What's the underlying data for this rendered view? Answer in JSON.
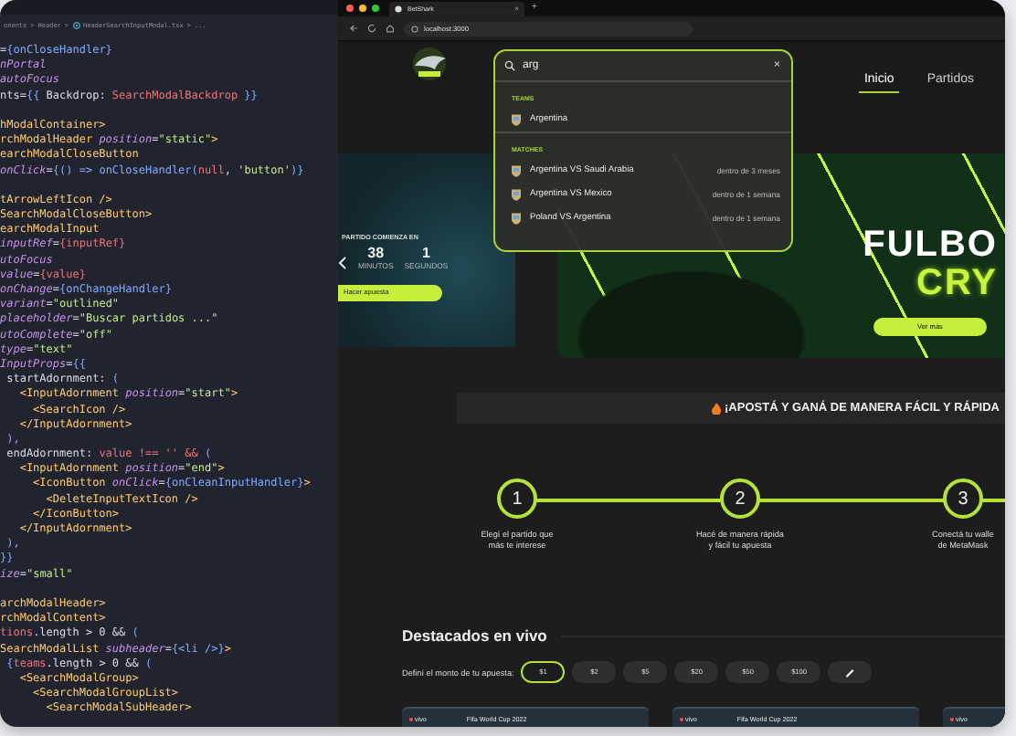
{
  "editor": {
    "breadcrumb": {
      "separator": ">",
      "parts": [
        {
          "text": "onents",
          "kind": "folder"
        },
        {
          "text": "Header",
          "kind": "folder"
        },
        {
          "text": "HeaderSearchInputModal.tsx",
          "kind": "file"
        },
        {
          "text": "...",
          "kind": "folder"
        }
      ]
    },
    "lines": [
      {
        "kind": "code",
        "tokens": [
          {
            "kind": "plain",
            "text": "="
          },
          {
            "kind": "expr",
            "text": "{onCloseHandler}"
          }
        ]
      },
      {
        "kind": "code",
        "tokens": [
          {
            "kind": "attr",
            "text": "nPortal"
          }
        ]
      },
      {
        "kind": "code",
        "tokens": [
          {
            "kind": "attr",
            "text": "autoFocus"
          }
        ]
      },
      {
        "kind": "code",
        "tokens": [
          {
            "kind": "plain",
            "text": "nts="
          },
          {
            "kind": "expr",
            "text": "{{ "
          },
          {
            "kind": "plain",
            "text": "Backdrop: "
          },
          {
            "kind": "prop",
            "text": "SearchModalBackdrop"
          },
          {
            "kind": "expr",
            "text": " }}"
          }
        ]
      },
      {
        "kind": "blank"
      },
      {
        "kind": "code",
        "tokens": [
          {
            "kind": "tag",
            "text": "hModalContainer>"
          }
        ]
      },
      {
        "kind": "code",
        "tokens": [
          {
            "kind": "tag",
            "text": "rchModalHeader "
          },
          {
            "kind": "attr",
            "text": "position"
          },
          {
            "kind": "plain",
            "text": "="
          },
          {
            "kind": "str",
            "text": "\"static\""
          },
          {
            "kind": "tag",
            "text": ">"
          }
        ]
      },
      {
        "kind": "code",
        "tokens": [
          {
            "kind": "tag",
            "text": "earchModalCloseButton"
          }
        ]
      },
      {
        "kind": "code",
        "tokens": [
          {
            "kind": "attr",
            "text": "onClick"
          },
          {
            "kind": "plain",
            "text": "="
          },
          {
            "kind": "expr",
            "text": "{() => onCloseHandler("
          },
          {
            "kind": "prop",
            "text": "null"
          },
          {
            "kind": "plain",
            "text": ", "
          },
          {
            "kind": "str",
            "text": "'button'"
          },
          {
            "kind": "expr",
            "text": ")}"
          }
        ]
      },
      {
        "kind": "blank"
      },
      {
        "kind": "code",
        "tokens": [
          {
            "kind": "tag",
            "text": "tArrowLeftIcon />"
          }
        ]
      },
      {
        "kind": "code",
        "tokens": [
          {
            "kind": "tag",
            "text": "SearchModalCloseButton>"
          }
        ]
      },
      {
        "kind": "code",
        "tokens": [
          {
            "kind": "tag",
            "text": "earchModalInput"
          }
        ]
      },
      {
        "kind": "code",
        "tokens": [
          {
            "kind": "attr",
            "text": "inputRef"
          },
          {
            "kind": "plain",
            "text": "="
          },
          {
            "kind": "prop",
            "text": "{inputRef}"
          }
        ]
      },
      {
        "kind": "code",
        "tokens": [
          {
            "kind": "attr",
            "text": "utoFocus"
          }
        ]
      },
      {
        "kind": "code",
        "tokens": [
          {
            "kind": "attr",
            "text": "value"
          },
          {
            "kind": "plain",
            "text": "="
          },
          {
            "kind": "prop",
            "text": "{value}"
          }
        ]
      },
      {
        "kind": "code",
        "tokens": [
          {
            "kind": "attr",
            "text": "onChange"
          },
          {
            "kind": "plain",
            "text": "="
          },
          {
            "kind": "expr",
            "text": "{onChangeHandler}"
          }
        ]
      },
      {
        "kind": "code",
        "tokens": [
          {
            "kind": "attr",
            "text": "variant"
          },
          {
            "kind": "plain",
            "text": "="
          },
          {
            "kind": "str",
            "text": "\"outlined\""
          }
        ]
      },
      {
        "kind": "code",
        "tokens": [
          {
            "kind": "attr",
            "text": "placeholder"
          },
          {
            "kind": "plain",
            "text": "="
          },
          {
            "kind": "str",
            "text": "\"Buscar partidos ...\""
          }
        ]
      },
      {
        "kind": "code",
        "tokens": [
          {
            "kind": "attr",
            "text": "utoComplete"
          },
          {
            "kind": "plain",
            "text": "="
          },
          {
            "kind": "str",
            "text": "\"off\""
          }
        ]
      },
      {
        "kind": "code",
        "tokens": [
          {
            "kind": "attr",
            "text": "type"
          },
          {
            "kind": "plain",
            "text": "="
          },
          {
            "kind": "str",
            "text": "\"text\""
          }
        ]
      },
      {
        "kind": "code",
        "tokens": [
          {
            "kind": "attr",
            "text": "InputProps"
          },
          {
            "kind": "plain",
            "text": "="
          },
          {
            "kind": "expr",
            "text": "{{"
          }
        ]
      },
      {
        "kind": "code",
        "tokens": [
          {
            "kind": "plain",
            "text": " startAdornment: "
          },
          {
            "kind": "expr",
            "text": "("
          }
        ]
      },
      {
        "kind": "code",
        "tokens": [
          {
            "kind": "tag",
            "text": "   <InputAdornment "
          },
          {
            "kind": "attr",
            "text": "position"
          },
          {
            "kind": "plain",
            "text": "="
          },
          {
            "kind": "str",
            "text": "\"start\""
          },
          {
            "kind": "tag",
            "text": ">"
          }
        ]
      },
      {
        "kind": "code",
        "tokens": [
          {
            "kind": "tag",
            "text": "     <SearchIcon />"
          }
        ]
      },
      {
        "kind": "code",
        "tokens": [
          {
            "kind": "tag",
            "text": "   </InputAdornment>"
          }
        ]
      },
      {
        "kind": "code",
        "tokens": [
          {
            "kind": "expr",
            "text": " ),"
          }
        ]
      },
      {
        "kind": "code",
        "tokens": [
          {
            "kind": "plain",
            "text": " endAdornment: "
          },
          {
            "kind": "prop",
            "text": "value !== '' && "
          },
          {
            "kind": "expr",
            "text": "("
          }
        ]
      },
      {
        "kind": "code",
        "tokens": [
          {
            "kind": "tag",
            "text": "   <InputAdornment "
          },
          {
            "kind": "attr",
            "text": "position"
          },
          {
            "kind": "plain",
            "text": "="
          },
          {
            "kind": "str",
            "text": "\"end\""
          },
          {
            "kind": "tag",
            "text": ">"
          }
        ]
      },
      {
        "kind": "code",
        "tokens": [
          {
            "kind": "tag",
            "text": "     <IconButton "
          },
          {
            "kind": "attr",
            "text": "onClick"
          },
          {
            "kind": "plain",
            "text": "="
          },
          {
            "kind": "expr",
            "text": "{onCleanInputHandler}"
          },
          {
            "kind": "tag",
            "text": ">"
          }
        ]
      },
      {
        "kind": "code",
        "tokens": [
          {
            "kind": "tag",
            "text": "       <DeleteInputTextIcon />"
          }
        ]
      },
      {
        "kind": "code",
        "tokens": [
          {
            "kind": "tag",
            "text": "     </IconButton>"
          }
        ]
      },
      {
        "kind": "code",
        "tokens": [
          {
            "kind": "tag",
            "text": "   </InputAdornment>"
          }
        ]
      },
      {
        "kind": "code",
        "tokens": [
          {
            "kind": "expr",
            "text": " ),"
          }
        ]
      },
      {
        "kind": "code",
        "tokens": [
          {
            "kind": "expr",
            "text": "}}"
          }
        ]
      },
      {
        "kind": "code",
        "tokens": [
          {
            "kind": "attr",
            "text": "ize"
          },
          {
            "kind": "plain",
            "text": "="
          },
          {
            "kind": "str",
            "text": "\"small\""
          }
        ]
      },
      {
        "kind": "blank"
      },
      {
        "kind": "code",
        "tokens": [
          {
            "kind": "tag",
            "text": "archModalHeader>"
          }
        ]
      },
      {
        "kind": "code",
        "tokens": [
          {
            "kind": "tag",
            "text": "rchModalContent>"
          }
        ]
      },
      {
        "kind": "code",
        "tokens": [
          {
            "kind": "prop",
            "text": "tions"
          },
          {
            "kind": "plain",
            "text": ".length > 0 && "
          },
          {
            "kind": "expr",
            "text": "("
          }
        ]
      },
      {
        "kind": "code",
        "tokens": [
          {
            "kind": "tag",
            "text": "SearchModalList "
          },
          {
            "kind": "attr",
            "text": "subheader"
          },
          {
            "kind": "plain",
            "text": "="
          },
          {
            "kind": "expr",
            "text": "{<li />}"
          },
          {
            "kind": "tag",
            "text": ">"
          }
        ]
      },
      {
        "kind": "code",
        "tokens": [
          {
            "kind": "expr",
            "text": " {"
          },
          {
            "kind": "prop",
            "text": "teams"
          },
          {
            "kind": "plain",
            "text": ".length > 0 && "
          },
          {
            "kind": "expr",
            "text": "("
          }
        ]
      },
      {
        "kind": "code",
        "tokens": [
          {
            "kind": "tag",
            "text": "   <SearchModalGroup>"
          }
        ]
      },
      {
        "kind": "code",
        "tokens": [
          {
            "kind": "tag",
            "text": "     <SearchModalGroupList>"
          }
        ]
      },
      {
        "kind": "code",
        "tokens": [
          {
            "kind": "tag",
            "text": "       <SearchModalSubHeader>"
          }
        ]
      }
    ]
  },
  "browser": {
    "tab": {
      "title": "BetShark",
      "close": "×",
      "selected": true
    },
    "new_tab": "+",
    "url": "localhost:3000"
  },
  "site": {
    "nav": [
      {
        "label": "Inicio",
        "selected": true
      },
      {
        "label": "Partidos",
        "selected": false
      }
    ]
  },
  "search": {
    "value": "arg",
    "clear": "×",
    "groups": [
      {
        "title": "TEAMS",
        "items": [
          {
            "name": "Argentina"
          }
        ]
      },
      {
        "title": "MATCHES",
        "items": [
          {
            "name": "Argentina VS Saudi Arabia",
            "time": "dentro de 3 meses"
          },
          {
            "name": "Argentina VS Mexico",
            "time": "dentro de 1 semana"
          },
          {
            "name": "Poland VS Argentina",
            "time": "dentro de 1 semana"
          }
        ]
      }
    ]
  },
  "countdown": {
    "title": "PARTIDO COMIENZA EN",
    "units": [
      {
        "value": "38",
        "label": "MINUTOS"
      },
      {
        "value": "1",
        "label": "SEGUNDOS"
      }
    ],
    "button": "Hacer apuesta"
  },
  "banner": {
    "lines": [
      "FULBO",
      "CRY"
    ],
    "button": "Ver más"
  },
  "tagline": "¡APOSTÁ Y GANÁ DE MANERA FÁCIL Y RÁPIDA",
  "steps": [
    {
      "number": "1",
      "lines": [
        "Elegí el partido que",
        "más te interese"
      ]
    },
    {
      "number": "2",
      "lines": [
        "Hacé de manera rápida",
        "y fácil tu apuesta"
      ]
    },
    {
      "number": "3",
      "lines": [
        "Conectá tu walle",
        "de MetaMask"
      ]
    }
  ],
  "live": {
    "title": "Destacados en vivo",
    "amount_label": "Definí el monto de tu apuesta:",
    "amounts": [
      {
        "label": "$1",
        "selected": true
      },
      {
        "label": "$2",
        "selected": false
      },
      {
        "label": "$5",
        "selected": false
      },
      {
        "label": "$20",
        "selected": false
      },
      {
        "label": "$50",
        "selected": false
      },
      {
        "label": "$100",
        "selected": false
      }
    ],
    "cards": [
      {
        "status": "vivo",
        "competition": "Fifa World Cup 2022"
      },
      {
        "status": "vivo",
        "competition": "Fifa World Cup 2022"
      },
      {
        "status": "vivo"
      }
    ]
  }
}
